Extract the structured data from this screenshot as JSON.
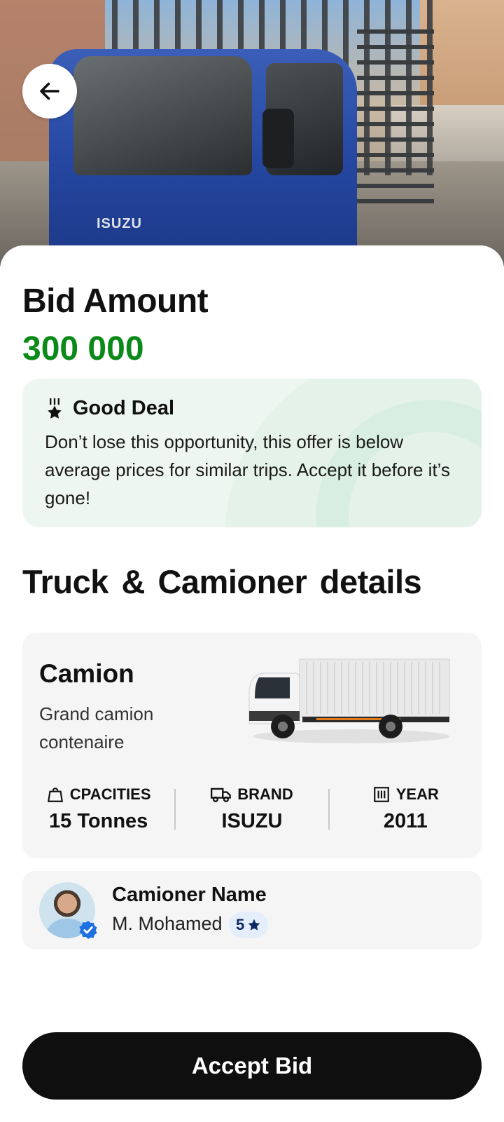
{
  "header": {
    "back_icon": "arrow-left-icon",
    "truck_badge_text": "ISUZU"
  },
  "bid": {
    "title": "Bid Amount",
    "amount": "300 000",
    "amount_color": "#0b8a1a"
  },
  "deal": {
    "icon": "award-star-icon",
    "label": "Good Deal",
    "message": "Don’t lose this opportunity, this offer is below average prices for similar trips. Accept it before it’s gone!"
  },
  "details": {
    "section_title": "Truck & Camioner  details",
    "truck": {
      "name": "Camion",
      "description": "Grand camion contenaire",
      "specs": [
        {
          "icon": "weight-icon",
          "label": "CPACITIES",
          "value": "15 Tonnes"
        },
        {
          "icon": "truck-icon",
          "label": "BRAND",
          "value": "ISUZU"
        },
        {
          "icon": "calendar-grid-icon",
          "label": "YEAR",
          "value": "2011"
        }
      ]
    },
    "camioner": {
      "title": "Camioner Name",
      "name": "M. Mohamed",
      "rating": "5",
      "rating_icon": "star-icon",
      "verified_icon": "verified-badge-icon"
    }
  },
  "actions": {
    "accept_label": "Accept Bid"
  }
}
